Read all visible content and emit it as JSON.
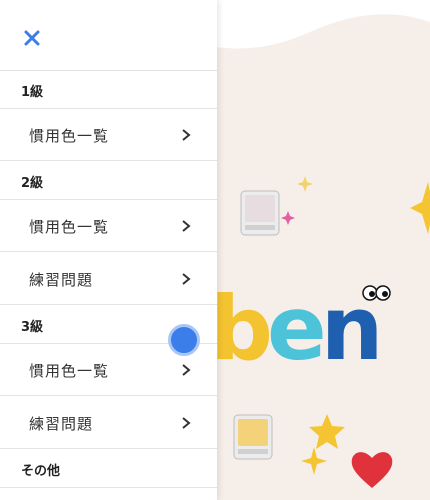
{
  "drawer": {
    "sections": [
      {
        "heading": "1級",
        "items": [
          {
            "label": "慣用色一覧"
          }
        ]
      },
      {
        "heading": "2級",
        "items": [
          {
            "label": "慣用色一覧"
          },
          {
            "label": "練習問題"
          }
        ]
      },
      {
        "heading": "3級",
        "items": [
          {
            "label": "慣用色一覧"
          },
          {
            "label": "練習問題"
          }
        ]
      },
      {
        "heading": "その他",
        "items": []
      }
    ]
  },
  "colors": {
    "accent": "#3b7de9",
    "letter_b": "#f4c430",
    "letter_e": "#4cc3d9",
    "letter_n": "#1f5fb0",
    "letter_n2": "#e8506e"
  },
  "icons": {
    "close": "close-icon",
    "chevron": "chevron-right-icon"
  }
}
